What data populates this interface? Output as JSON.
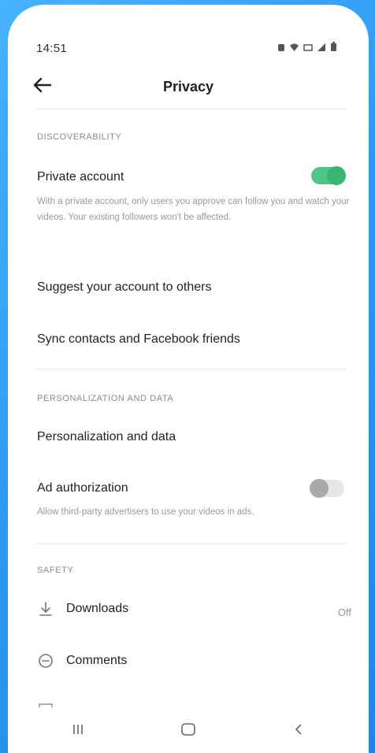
{
  "status": {
    "time": "14:51"
  },
  "header": {
    "title": "Privacy"
  },
  "discoverability": {
    "section_label": "DISCOVERABILITY",
    "private_account": {
      "title": "Private account",
      "description": "With a private account, only users you approve can follow you and watch your videos. Your existing followers won't be affected.",
      "enabled": true
    },
    "suggest_account": "Suggest your account to others",
    "sync_contacts": "Sync contacts and Facebook friends"
  },
  "personalization": {
    "section_label": "PERSONALIZATION AND DATA",
    "personalization_data": "Personalization and data",
    "ad_authorization": {
      "title": "Ad authorization",
      "description": "Allow third-party advertisers to use your videos in ads.",
      "enabled": false
    }
  },
  "safety": {
    "section_label": "SAFETY",
    "downloads": {
      "label": "Downloads",
      "value": "Off",
      "icon": "download-icon"
    },
    "comments": {
      "label": "Comments",
      "icon": "comment-icon"
    }
  },
  "colors": {
    "toggle_on": "#38b56f",
    "toggle_off": "#a9a9a9",
    "background_frame": "#2f9bf0"
  }
}
